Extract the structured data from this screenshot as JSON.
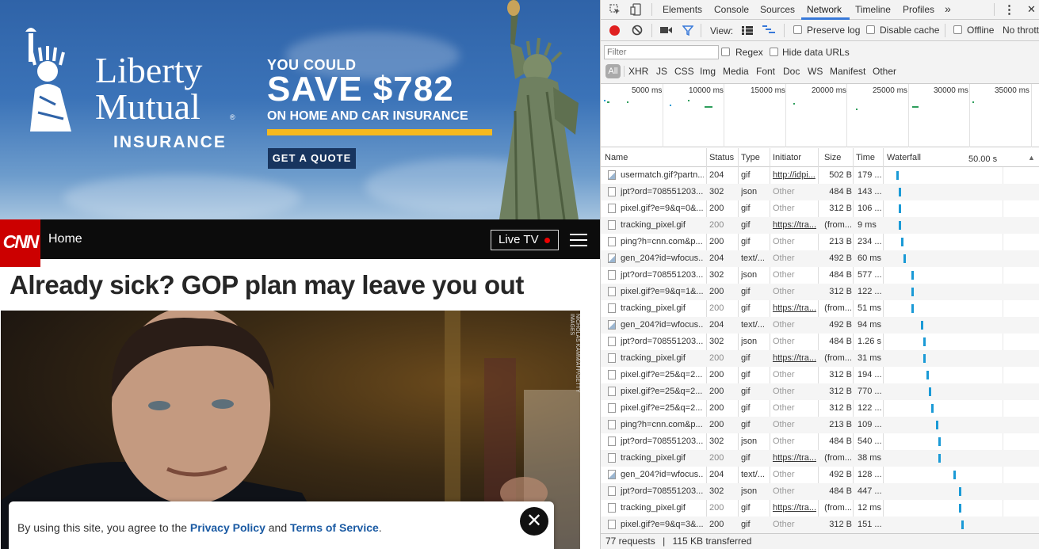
{
  "ad": {
    "brand_line1": "Liberty",
    "brand_line2": "Mutual",
    "brand_line3": "INSURANCE",
    "registered_mark": "®",
    "you_could": "YOU COULD",
    "save": "SAVE $782",
    "subline": "ON HOME AND CAR INSURANCE",
    "cta": "GET A QUOTE",
    "colors": {
      "sky": "#3b73b8",
      "accent": "#f5b91f",
      "cta_bg": "#18355f"
    }
  },
  "cnn": {
    "logo": "CNN",
    "nav_home": "Home",
    "live_tv": "Live TV",
    "headline": "Already sick? GOP plan may leave you out",
    "photo_credit": "NICHOLAS KAMM/AFP/GETTY IMAGES",
    "cookie": {
      "prefix": "By using this site, you agree to the ",
      "privacy": "Privacy Policy",
      "and": " and ",
      "terms": "Terms of Service",
      "suffix": "."
    },
    "close_symbol": "✕"
  },
  "devtools": {
    "tabs": [
      "Elements",
      "Console",
      "Sources",
      "Network",
      "Timeline",
      "Profiles"
    ],
    "active_tab": "Network",
    "more_tabs": "»",
    "kebab": "⋮",
    "close": "✕",
    "toolbar": {
      "view_label": "View:",
      "preserve_log": "Preserve log",
      "disable_cache": "Disable cache",
      "offline": "Offline",
      "throttle": "No thrott"
    },
    "filter": {
      "placeholder": "Filter",
      "regex": "Regex",
      "hide_data_urls": "Hide data URLs",
      "all": "All",
      "types": [
        "XHR",
        "JS",
        "CSS",
        "Img",
        "Media",
        "Font",
        "Doc",
        "WS",
        "Manifest",
        "Other"
      ]
    },
    "overview_ticks": [
      "5000 ms",
      "10000 ms",
      "15000 ms",
      "20000 ms",
      "25000 ms",
      "30000 ms",
      "35000 ms"
    ],
    "columns": {
      "name": "Name",
      "status": "Status",
      "type": "Type",
      "initiator": "Initiator",
      "size": "Size",
      "time": "Time",
      "waterfall": "Waterfall",
      "waterfall_scale": "50.00 s",
      "sort_arrow": "▲"
    },
    "rows": [
      {
        "name": "usermatch.gif?partn...",
        "status": "204",
        "type": "gif",
        "initiator": "http://idpi...",
        "size": "502 B",
        "time": "179 ...",
        "wf": 0.05,
        "img": true
      },
      {
        "name": "jpt?ord=708551203...",
        "status": "302",
        "type": "json",
        "initiator": "Other",
        "size": "484 B",
        "time": "143 ...",
        "wf": 0.06,
        "img": false
      },
      {
        "name": "pixel.gif?e=9&q=0&...",
        "status": "200",
        "type": "gif",
        "initiator": "Other",
        "size": "312 B",
        "time": "106 ...",
        "wf": 0.06,
        "img": false
      },
      {
        "name": "tracking_pixel.gif",
        "status": "200",
        "type": "gif",
        "initiator": "https://tra...",
        "size": "(from...",
        "time": "9 ms",
        "wf": 0.06,
        "img": false,
        "cache": true
      },
      {
        "name": "ping?h=cnn.com&p...",
        "status": "200",
        "type": "gif",
        "initiator": "Other",
        "size": "213 B",
        "time": "234 ...",
        "wf": 0.07,
        "img": false
      },
      {
        "name": "gen_204?id=wfocus...",
        "status": "204",
        "type": "text/...",
        "initiator": "Other",
        "size": "492 B",
        "time": "60 ms",
        "wf": 0.08,
        "img": true
      },
      {
        "name": "jpt?ord=708551203...",
        "status": "302",
        "type": "json",
        "initiator": "Other",
        "size": "484 B",
        "time": "577 ...",
        "wf": 0.11,
        "img": false
      },
      {
        "name": "pixel.gif?e=9&q=1&...",
        "status": "200",
        "type": "gif",
        "initiator": "Other",
        "size": "312 B",
        "time": "122 ...",
        "wf": 0.11,
        "img": false
      },
      {
        "name": "tracking_pixel.gif",
        "status": "200",
        "type": "gif",
        "initiator": "https://tra...",
        "size": "(from...",
        "time": "51 ms",
        "wf": 0.11,
        "img": false,
        "cache": true
      },
      {
        "name": "gen_204?id=wfocus...",
        "status": "204",
        "type": "text/...",
        "initiator": "Other",
        "size": "492 B",
        "time": "94 ms",
        "wf": 0.15,
        "img": true
      },
      {
        "name": "jpt?ord=708551203...",
        "status": "302",
        "type": "json",
        "initiator": "Other",
        "size": "484 B",
        "time": "1.26 s",
        "wf": 0.16,
        "img": false
      },
      {
        "name": "tracking_pixel.gif",
        "status": "200",
        "type": "gif",
        "initiator": "https://tra...",
        "size": "(from...",
        "time": "31 ms",
        "wf": 0.16,
        "img": false,
        "cache": true
      },
      {
        "name": "pixel.gif?e=25&q=2...",
        "status": "200",
        "type": "gif",
        "initiator": "Other",
        "size": "312 B",
        "time": "194 ...",
        "wf": 0.17,
        "img": false
      },
      {
        "name": "pixel.gif?e=25&q=2...",
        "status": "200",
        "type": "gif",
        "initiator": "Other",
        "size": "312 B",
        "time": "770 ...",
        "wf": 0.18,
        "img": false
      },
      {
        "name": "pixel.gif?e=25&q=2...",
        "status": "200",
        "type": "gif",
        "initiator": "Other",
        "size": "312 B",
        "time": "122 ...",
        "wf": 0.19,
        "img": false
      },
      {
        "name": "ping?h=cnn.com&p...",
        "status": "200",
        "type": "gif",
        "initiator": "Other",
        "size": "213 B",
        "time": "109 ...",
        "wf": 0.21,
        "img": false
      },
      {
        "name": "jpt?ord=708551203...",
        "status": "302",
        "type": "json",
        "initiator": "Other",
        "size": "484 B",
        "time": "540 ...",
        "wf": 0.22,
        "img": false
      },
      {
        "name": "tracking_pixel.gif",
        "status": "200",
        "type": "gif",
        "initiator": "https://tra...",
        "size": "(from...",
        "time": "38 ms",
        "wf": 0.22,
        "img": false,
        "cache": true
      },
      {
        "name": "gen_204?id=wfocus...",
        "status": "204",
        "type": "text/...",
        "initiator": "Other",
        "size": "492 B",
        "time": "128 ...",
        "wf": 0.28,
        "img": true
      },
      {
        "name": "jpt?ord=708551203...",
        "status": "302",
        "type": "json",
        "initiator": "Other",
        "size": "484 B",
        "time": "447 ...",
        "wf": 0.3,
        "img": false
      },
      {
        "name": "tracking_pixel.gif",
        "status": "200",
        "type": "gif",
        "initiator": "https://tra...",
        "size": "(from...",
        "time": "12 ms",
        "wf": 0.3,
        "img": false,
        "cache": true
      },
      {
        "name": "pixel.gif?e=9&q=3&...",
        "status": "200",
        "type": "gif",
        "initiator": "Other",
        "size": "312 B",
        "time": "151 ...",
        "wf": 0.31,
        "img": false
      }
    ],
    "status_bar": {
      "requests": "77 requests",
      "separator": "|",
      "transferred": "115 KB transferred"
    },
    "colors": {
      "bar": "#1a9ad6",
      "record": "#e02020",
      "active_tab": "#3879d9"
    }
  }
}
